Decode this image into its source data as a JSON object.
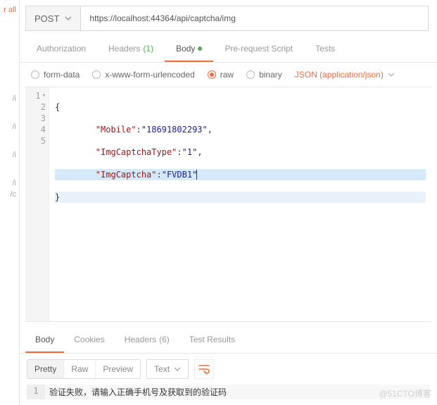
{
  "sidebar": {
    "items": [
      {
        "label": "r all"
      },
      {
        "label": "/i"
      },
      {
        "label": "/i"
      },
      {
        "label": "/i"
      },
      {
        "label": "/i"
      },
      {
        "label": "/c"
      }
    ]
  },
  "request": {
    "method": "POST",
    "url": "https://localhost:44364/api/captcha/img"
  },
  "tabs": {
    "authorization": "Authorization",
    "headers": "Headers",
    "headers_count": "(1)",
    "body": "Body",
    "prerequest": "Pre-request Script",
    "tests": "Tests"
  },
  "body_types": {
    "form_data": "form-data",
    "xwww": "x-www-form-urlencoded",
    "raw": "raw",
    "binary": "binary",
    "content_type": "JSON (application/json)"
  },
  "editor": {
    "lines": [
      "1",
      "2",
      "3",
      "4",
      "5"
    ],
    "open_brace": "{",
    "close_brace": "}",
    "kv": [
      {
        "key": "\"Mobile\"",
        "colon": ":",
        "val": "\"18691802293\"",
        "comma": ","
      },
      {
        "key": "\"ImgCaptchaType\"",
        "colon": ":",
        "val": "\"1\"",
        "comma": ","
      },
      {
        "key": "\"ImgCaptcha\"",
        "colon": ":",
        "val": "\"FVDB1\"",
        "comma": ""
      }
    ]
  },
  "response_tabs": {
    "body": "Body",
    "cookies": "Cookies",
    "headers": "Headers",
    "headers_count": "(6)",
    "test_results": "Test Results"
  },
  "response_toolbar": {
    "pretty": "Pretty",
    "raw": "Raw",
    "preview": "Preview",
    "format": "Text"
  },
  "response_body": {
    "line_no": "1",
    "text": "验证失败，请输入正确手机号及获取到的验证码"
  },
  "watermark": "@51CTO博客"
}
